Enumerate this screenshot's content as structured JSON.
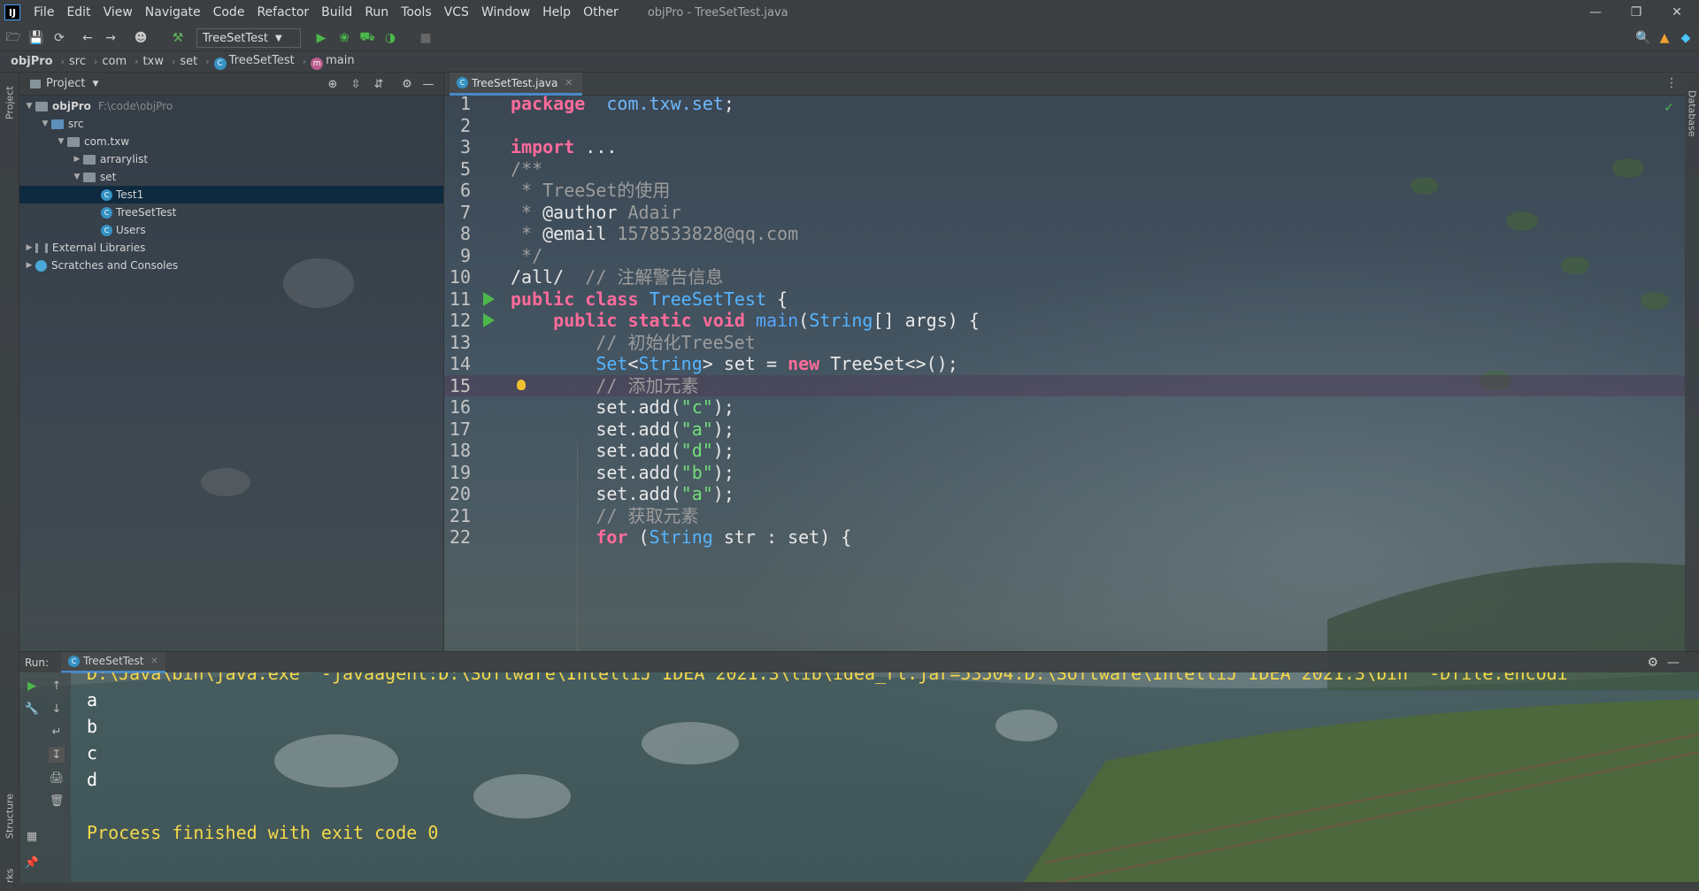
{
  "window": {
    "title": "objPro - TreeSetTest.java",
    "logo_text": "IJ"
  },
  "menu": [
    "File",
    "Edit",
    "View",
    "Navigate",
    "Code",
    "Refactor",
    "Build",
    "Run",
    "Tools",
    "VCS",
    "Window",
    "Help",
    "Other"
  ],
  "toolbar": {
    "run_config": "TreeSetTest"
  },
  "breadcrumb": {
    "items": [
      "objPro",
      "src",
      "com",
      "txw",
      "set"
    ],
    "class_name": "TreeSetTest",
    "method_name": "main"
  },
  "side_tabs": {
    "project": "Project",
    "structure": "Structure",
    "bookmarks": "Bookmarks",
    "database": "Database"
  },
  "project_panel": {
    "title": "Project",
    "root": {
      "name": "objPro",
      "path": "F:\\code\\objPro"
    },
    "src": "src",
    "package": "com.txw",
    "arrarylist": "arrarylist",
    "set": "set",
    "files": [
      "Test1",
      "TreeSetTest",
      "Users"
    ],
    "external_libraries": "External Libraries",
    "scratches": "Scratches and Consoles"
  },
  "editor": {
    "tab_label": "TreeSetTest.java",
    "lines": [
      {
        "n": "1",
        "parts": [
          [
            "kwb",
            "package"
          ],
          [
            "",
            "  "
          ],
          [
            "pkg",
            "com.txw.set"
          ],
          [
            "",
            ";"
          ]
        ]
      },
      {
        "n": "2",
        "parts": []
      },
      {
        "n": "3",
        "parts": [
          [
            "kwb",
            "import"
          ],
          [
            "",
            " ..."
          ]
        ]
      },
      {
        "n": "5",
        "parts": [
          [
            "cmt",
            "/**"
          ]
        ]
      },
      {
        "n": "6",
        "parts": [
          [
            "cmt",
            " * TreeSet的使用"
          ]
        ]
      },
      {
        "n": "7",
        "parts": [
          [
            "cmt",
            " * "
          ],
          [
            "ann",
            "@author"
          ],
          [
            "cmt",
            " Adair"
          ]
        ]
      },
      {
        "n": "8",
        "parts": [
          [
            "cmt",
            " * "
          ],
          [
            "ann",
            "@email"
          ],
          [
            "cmt",
            " 1578533828@qq.com"
          ]
        ]
      },
      {
        "n": "9",
        "parts": [
          [
            "cmt",
            " */"
          ]
        ]
      },
      {
        "n": "10",
        "parts": [
          [
            "",
            "/all/  "
          ],
          [
            "cmt",
            "// 注解警告信息"
          ]
        ]
      },
      {
        "n": "11",
        "parts": [
          [
            "kwb",
            "public"
          ],
          [
            "",
            " "
          ],
          [
            "kwb",
            "class"
          ],
          [
            "",
            " "
          ],
          [
            "cls",
            "TreeSetTest"
          ],
          [
            "",
            " {"
          ]
        ]
      },
      {
        "n": "12",
        "parts": [
          [
            "",
            "    "
          ],
          [
            "kwb",
            "public"
          ],
          [
            "",
            " "
          ],
          [
            "kwb",
            "static"
          ],
          [
            "",
            " "
          ],
          [
            "kwb",
            "void"
          ],
          [
            "",
            " "
          ],
          [
            "fn",
            "main"
          ],
          [
            "",
            "("
          ],
          [
            "cls",
            "String"
          ],
          [
            "",
            "[] args) {"
          ]
        ]
      },
      {
        "n": "13",
        "parts": [
          [
            "",
            "        "
          ],
          [
            "cmt",
            "// 初始化TreeSet"
          ]
        ]
      },
      {
        "n": "14",
        "parts": [
          [
            "",
            "        "
          ],
          [
            "cls",
            "Set"
          ],
          [
            "",
            "<"
          ],
          [
            "cls",
            "String"
          ],
          [
            "",
            "> set = "
          ],
          [
            "kwb",
            "new"
          ],
          [
            "",
            " TreeSet<>();"
          ]
        ]
      },
      {
        "n": "15",
        "parts": [
          [
            "",
            "        "
          ],
          [
            "cmt",
            "// 添加元素"
          ]
        ]
      },
      {
        "n": "16",
        "parts": [
          [
            "",
            "        set.add("
          ],
          [
            "str",
            "\"c\""
          ],
          [
            "",
            ");"
          ]
        ]
      },
      {
        "n": "17",
        "parts": [
          [
            "",
            "        set.add("
          ],
          [
            "str",
            "\"a\""
          ],
          [
            "",
            ");"
          ]
        ]
      },
      {
        "n": "18",
        "parts": [
          [
            "",
            "        set.add("
          ],
          [
            "str",
            "\"d\""
          ],
          [
            "",
            ");"
          ]
        ]
      },
      {
        "n": "19",
        "parts": [
          [
            "",
            "        set.add("
          ],
          [
            "str",
            "\"b\""
          ],
          [
            "",
            ");"
          ]
        ]
      },
      {
        "n": "20",
        "parts": [
          [
            "",
            "        set.add("
          ],
          [
            "str",
            "\"a\""
          ],
          [
            "",
            ");"
          ]
        ]
      },
      {
        "n": "21",
        "parts": [
          [
            "",
            "        "
          ],
          [
            "cmt",
            "// 获取元素"
          ]
        ]
      },
      {
        "n": "22",
        "parts": [
          [
            "",
            "        "
          ],
          [
            "kwb",
            "for"
          ],
          [
            "",
            " ("
          ],
          [
            "cls",
            "String"
          ],
          [
            "",
            " str : set) {"
          ]
        ]
      }
    ]
  },
  "run_panel": {
    "label": "Run:",
    "tab": "TreeSetTest",
    "command": "D:\\Java\\bin\\java.exe \"-javaagent:D:\\Software\\IntelliJ IDEA 2021.3\\lib\\idea_rt.jar=53504:D:\\Software\\IntelliJ IDEA 2021.3\\bin\" -Dfile.encodi",
    "output": [
      "a",
      "b",
      "c",
      "d"
    ],
    "finish": "Process finished with exit code 0"
  },
  "colors": {
    "keyword": "#ff6b9a",
    "comment": "#9c9c9c",
    "string": "#74e07a",
    "class": "#55b4ff",
    "console_finish": "#f5d84a",
    "selection": "#0d293e"
  }
}
